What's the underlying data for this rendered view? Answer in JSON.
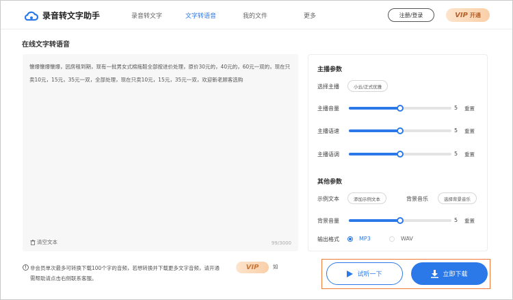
{
  "nav": {
    "app_title": "录音转文字助手",
    "items": [
      {
        "label": "录音转文字",
        "active": false
      },
      {
        "label": "文字转语音",
        "active": true
      },
      {
        "label": "我的文件",
        "active": false
      },
      {
        "label": "更多",
        "active": false
      }
    ],
    "login_label": "注册/登录",
    "vip_mark": "VIP",
    "vip_label": "开通"
  },
  "page": {
    "section_title": "在线文字转语音"
  },
  "editor": {
    "content": "懐爆懐爆懐爆，因房租到期，现有一批男女式棉拖鞋全部按进价处理，原价30元的，40元的，60元一双的，现在只卖10元，15元，35元一双，全部处理，现在只卖10元，15元，35元一双，欢迎新老顾客选购",
    "clear_label": "清空文本",
    "char_count": "99/3000"
  },
  "params": {
    "main_title": "主播参数",
    "anchor_label": "选择主播",
    "anchor_value": "小云/正式优雅",
    "sliders": [
      {
        "label": "主播音量",
        "value": "5",
        "level": 0.5,
        "reset": "重置"
      },
      {
        "label": "主播语速",
        "value": "5",
        "level": 0.5,
        "reset": "重置"
      },
      {
        "label": "主播语调",
        "value": "5",
        "level": 0.5,
        "reset": "重置"
      }
    ],
    "other_title": "其他参数",
    "sample_label": "示例文本",
    "sample_button": "添加示例文本",
    "bgm_label": "背景音乐",
    "bgm_button": "选择背景音乐",
    "bg_volume": {
      "label": "背景音量",
      "value": "5",
      "level": 0.5,
      "reset": "重置"
    },
    "format_label": "输出格式",
    "formats": [
      {
        "label": "MP3",
        "selected": true
      },
      {
        "label": "WAV",
        "selected": false
      }
    ]
  },
  "notice": {
    "icon": "info-icon",
    "text": "非会员单次最多可转换下载100个字的音频，若想转换并下载更多文字音频，请开通",
    "vip": "VIP",
    "tail": "如",
    "line2": "需帮助请点击右侧联系客服。"
  },
  "actions": {
    "listen_label": "试听一下",
    "download_label": "立即下载"
  },
  "colors": {
    "accent": "#2b79e8",
    "highlight_border": "#f07a3a",
    "vip_text": "#b4612a"
  }
}
